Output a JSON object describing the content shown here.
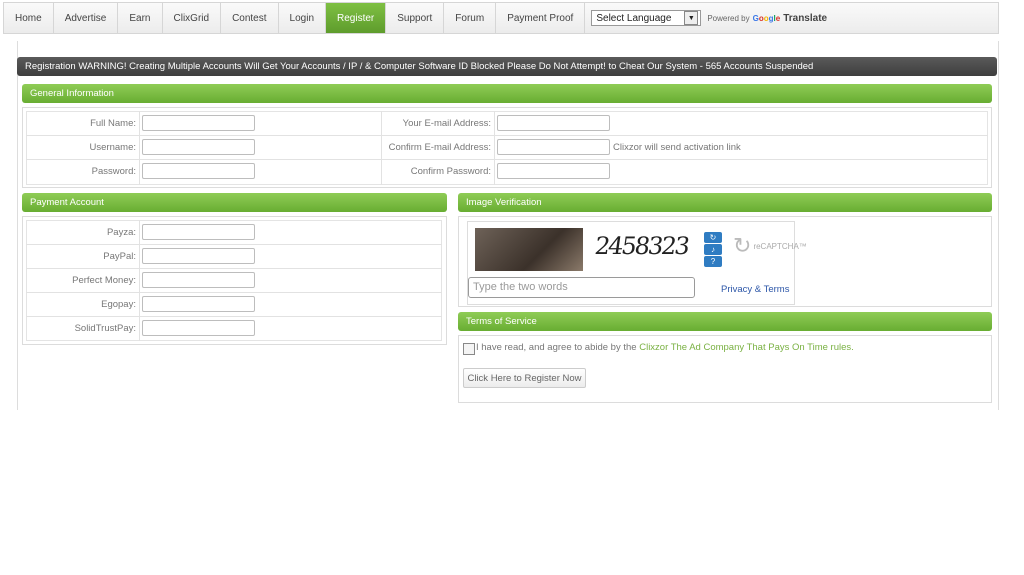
{
  "nav": {
    "items": [
      "Home",
      "Advertise",
      "Earn",
      "ClixGrid",
      "Contest",
      "Login",
      "Register",
      "Support",
      "Forum",
      "Payment Proof"
    ],
    "active": "Register",
    "language_select": "Select Language",
    "powered_by": "Powered by",
    "google": "Google",
    "translate": "Translate"
  },
  "warning": "Registration WARNING! Creating Multiple Accounts Will Get Your Accounts / IP / & Computer Software ID Blocked  Please Do Not Attempt! to Cheat Our System - 565 Accounts Suspended",
  "general": {
    "title": "General Information",
    "full_name": "Full Name:",
    "username": "Username:",
    "password": "Password:",
    "email": "Your E-mail Address:",
    "confirm_email": "Confirm E-mail Address:",
    "confirm_password": "Confirm Password:",
    "activation_hint": "Clixzor will send activation link"
  },
  "payment": {
    "title": "Payment Account",
    "labels": [
      "Payza:",
      "PayPal:",
      "Perfect Money:",
      "Egopay:",
      "SolidTrustPay:"
    ]
  },
  "verification": {
    "title": "Image Verification",
    "captcha_text": "2458323",
    "placeholder": "Type the two words",
    "privacy": "Privacy & Terms",
    "recaptcha": "reCAPTCHA™"
  },
  "terms": {
    "title": "Terms of Service",
    "text_prefix": "I have read, and agree to abide by the",
    "link": "Clixzor The Ad Company That Pays On Time rules.",
    "register_button": "Click Here to Register Now"
  }
}
